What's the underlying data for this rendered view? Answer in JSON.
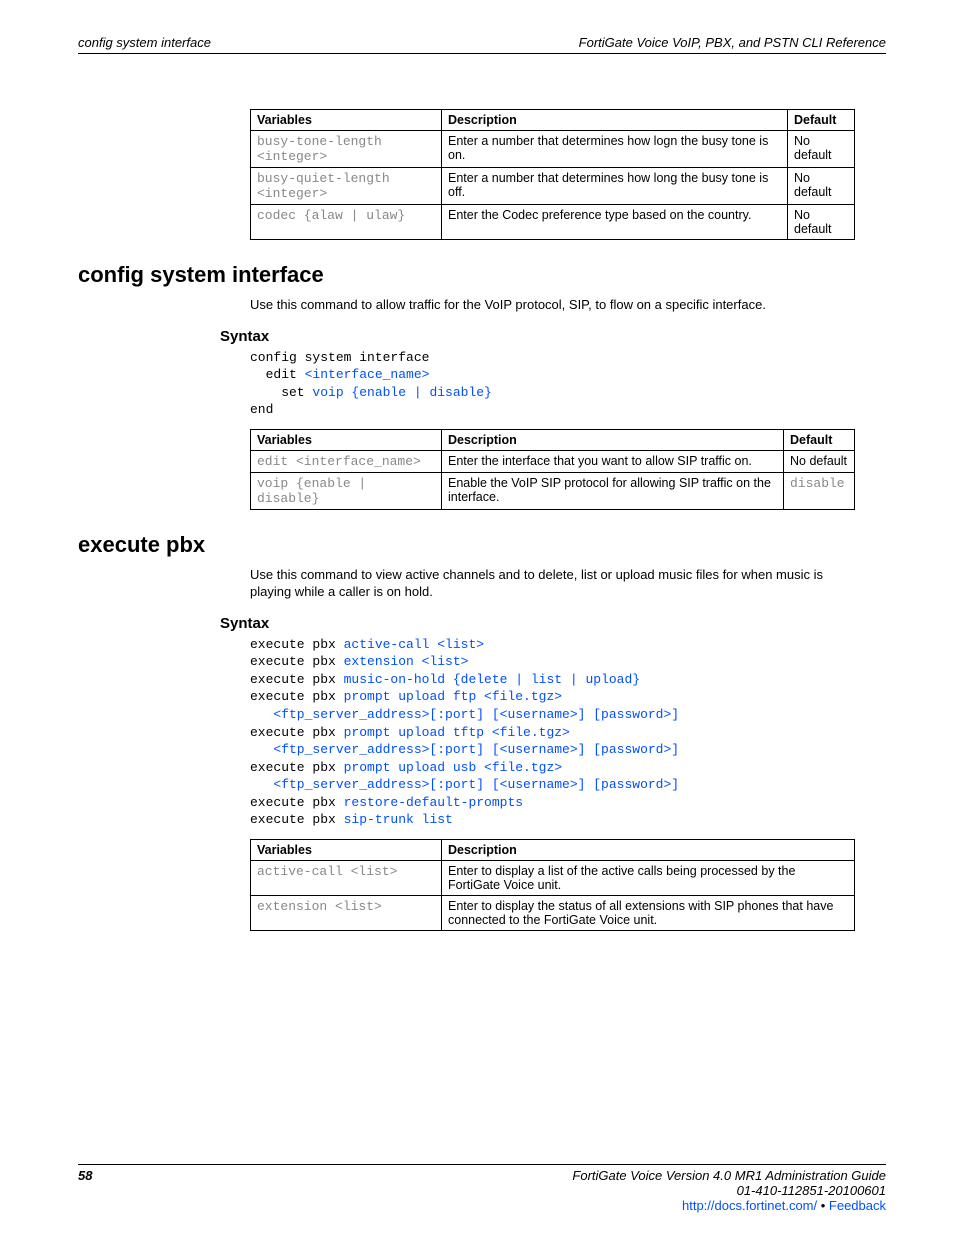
{
  "header": {
    "left": "config system interface",
    "right": "FortiGate Voice VoIP, PBX, and PSTN CLI Reference"
  },
  "table1": {
    "headers": [
      "Variables",
      "Description",
      "Default"
    ],
    "rows": [
      {
        "var": "busy-tone-length <integer>",
        "desc": "Enter a number that determines how logn the busy tone is on.",
        "def": "No default"
      },
      {
        "var": "busy-quiet-length <integer>",
        "desc": "Enter a number that determines how long the busy tone is off.",
        "def": "No default"
      },
      {
        "var": "codec {alaw | ulaw}",
        "desc": "Enter the Codec preference type based on the country.",
        "def": "No default"
      }
    ]
  },
  "section1": {
    "title": "config system interface",
    "intro": "Use this command to allow traffic for the VoIP protocol, SIP, to flow on a specific interface.",
    "syntax_label": "Syntax",
    "code": {
      "l1a": "config system interface",
      "l2a": "  edit ",
      "l2b": "<interface_name>",
      "l3a": "    set ",
      "l3b": "voip {enable | disable}",
      "l4a": "end"
    }
  },
  "table2": {
    "headers": [
      "Variables",
      "Description",
      "Default"
    ],
    "rows": [
      {
        "var": "edit <interface_name>",
        "desc": "Enter the interface that you want to allow SIP traffic on.",
        "def": "No default",
        "defmono": false
      },
      {
        "var": "voip {enable | disable}",
        "desc": "Enable the VoIP SIP protocol for allowing SIP traffic on the interface.",
        "def": "disable",
        "defmono": true
      }
    ]
  },
  "section2": {
    "title": "execute pbx",
    "intro": "Use this command to view active channels and to delete, list or upload music files for when music is playing while a caller is on hold.",
    "syntax_label": "Syntax",
    "code": {
      "prefix": "execute pbx ",
      "l1": "active-call <list>",
      "l2": "extension <list>",
      "l3": "music-on-hold {delete | list | upload}",
      "l4a": "prompt upload ftp <file.tgz>",
      "l4b": "   <ftp_server_address>[:port] [<username>] [password>]",
      "l5a": "prompt upload tftp <file.tgz>",
      "l5b": "   <ftp_server_address>[:port] [<username>] [password>]",
      "l6a": "prompt upload usb <file.tgz>",
      "l6b": "   <ftp_server_address>[:port] [<username>] [password>]",
      "l7": "restore-default-prompts",
      "l8": "sip-trunk list"
    }
  },
  "table3": {
    "headers": [
      "Variables",
      "Description"
    ],
    "rows": [
      {
        "var": "active-call <list>",
        "desc": "Enter to display a list of the active calls being processed by the FortiGate Voice unit."
      },
      {
        "var": "extension <list>",
        "desc": "Enter to display the status of all extensions with SIP phones that have connected to the FortiGate Voice unit."
      }
    ]
  },
  "footer": {
    "page": "58",
    "line1": "FortiGate Voice Version 4.0 MR1 Administration Guide",
    "line2": "01-410-112851-20100601",
    "link": "http://docs.fortinet.com/",
    "sep": " • ",
    "feedback": "Feedback"
  }
}
